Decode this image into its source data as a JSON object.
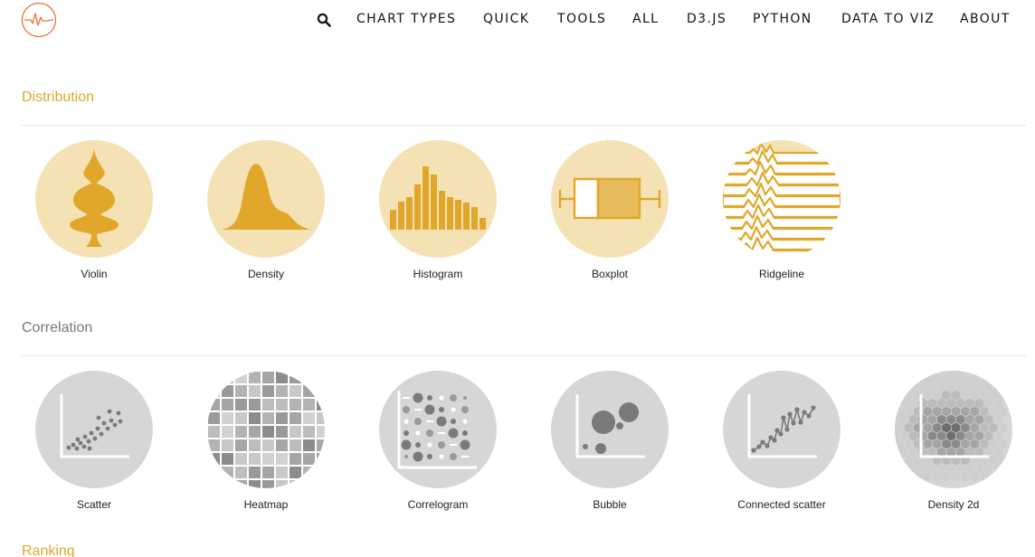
{
  "header": {
    "logo_icon": "heartbeat-line-logo",
    "search_icon": "search-icon",
    "nav": [
      {
        "label": "CHART TYPES"
      },
      {
        "label": "QUICK"
      },
      {
        "label": "TOOLS"
      },
      {
        "label": "ALL"
      },
      {
        "label": "D3.JS"
      },
      {
        "label": "PYTHON"
      },
      {
        "label": "DATA TO VIZ"
      },
      {
        "label": "ABOUT"
      }
    ]
  },
  "sections": [
    {
      "title": "Distribution",
      "color": "#e0a72a",
      "items": [
        {
          "label": "Violin",
          "icon": "violin-icon"
        },
        {
          "label": "Density",
          "icon": "density-icon"
        },
        {
          "label": "Histogram",
          "icon": "histogram-icon"
        },
        {
          "label": "Boxplot",
          "icon": "boxplot-icon"
        },
        {
          "label": "Ridgeline",
          "icon": "ridgeline-icon"
        }
      ]
    },
    {
      "title": "Correlation",
      "color": "#777777",
      "items": [
        {
          "label": "Scatter",
          "icon": "scatter-icon"
        },
        {
          "label": "Heatmap",
          "icon": "heatmap-icon"
        },
        {
          "label": "Correlogram",
          "icon": "correlogram-icon"
        },
        {
          "label": "Bubble",
          "icon": "bubble-icon"
        },
        {
          "label": "Connected scatter",
          "icon": "connected-scatter-icon"
        },
        {
          "label": "Density 2d",
          "icon": "density-2d-icon"
        }
      ]
    },
    {
      "title": "Ranking",
      "color": "#e0a72a"
    }
  ],
  "colors": {
    "gold": "#e0a72a",
    "gold_light": "#f5e2b4",
    "gray_bg": "#d6d6d6",
    "gray_mark": "#7a7a7a",
    "logo_orange": "#e8743b"
  }
}
